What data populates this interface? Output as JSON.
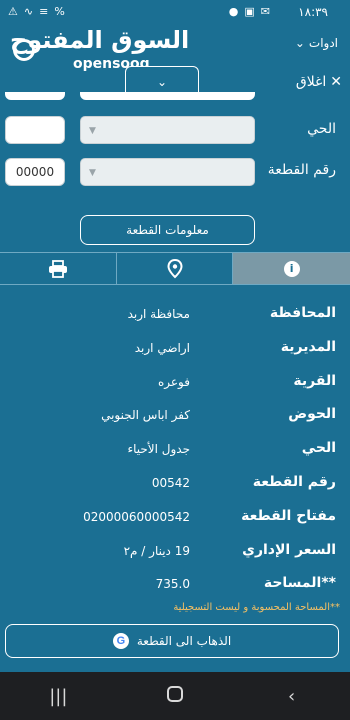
{
  "status": {
    "time": "١٨:٣٩",
    "left_icons": [
      "⚠",
      "∿",
      "≡",
      "%"
    ],
    "right_icons": [
      "●",
      "▣",
      "✉"
    ]
  },
  "appbar": {
    "logo_ar": "السوق المفتوح",
    "logo_en": "opensooq",
    "tools_label": "ادوات",
    "collapse_icon": "chevron-down-icon"
  },
  "close_label": "اغلاق",
  "form": {
    "district_label": "الحي",
    "parcel_label": "رقم القطعة",
    "parcel_value": "00000",
    "info_button": "معلومات القطعة"
  },
  "details": [
    {
      "label": "المحافظة",
      "value": "محافظة اربد"
    },
    {
      "label": "المديرية",
      "value": "اراضي اربد"
    },
    {
      "label": "القرية",
      "value": "فوعره"
    },
    {
      "label": "الحوض",
      "value": "كفر اباس الجنوبي"
    },
    {
      "label": "الحي",
      "value": "جدول الأحياء"
    },
    {
      "label": "رقم القطعة",
      "value": "00542"
    },
    {
      "label": "مفتاح القطعة",
      "value": "02000060000542"
    },
    {
      "label": "السعر الإداري",
      "value": "19 دينار / م٢"
    },
    {
      "label": "**المساحة",
      "value": "735.0"
    }
  ],
  "note": "**المساحة المحسوبة و ليست التسجيلية",
  "goto_button": "الذهاب الى القطعة",
  "colors": {
    "background": "#1b6f93",
    "active_tab": "#7b99a6",
    "note": "#f6c063",
    "nav": "#1e1f22"
  }
}
